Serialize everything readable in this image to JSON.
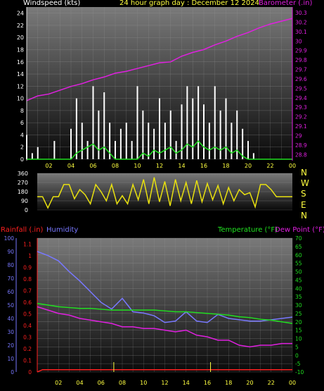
{
  "colors": {
    "wind_axis": "#ffffff",
    "gust": "#ffffff",
    "avg_wind": "#20e020",
    "barometer": "#e020e0",
    "direction": "#e8e010",
    "rain": "#ff2020",
    "humidity": "#7878ff",
    "temperature": "#20e020",
    "dewpoint": "#e020e0",
    "time_axis": "#ffff40"
  },
  "header": {
    "windspeed_label": "Windspeed (kts)",
    "title": "24 hour graph day : December 12 2024",
    "barometer_label": "Barometer (.in)"
  },
  "direction_letters": [
    "N",
    "W",
    "S",
    "E",
    "N"
  ],
  "lower_header": {
    "rainfall_label": "Rainfall (.in)",
    "humidity_label": "Humidity",
    "temperature_label": "Temperature (°F)",
    "dewpoint_label": "Dew Point (°F)"
  },
  "chart_data": [
    {
      "id": "wind-barometer",
      "type": "area",
      "title": "24 hour graph day : December 12 2024",
      "x_ticks": [
        "02",
        "04",
        "06",
        "08",
        "10",
        "12",
        "14",
        "16",
        "18",
        "20",
        "22",
        "00"
      ],
      "y_left": {
        "label": "Windspeed (kts)",
        "ticks": [
          0,
          2,
          4,
          6,
          8,
          10,
          12,
          14,
          16,
          18,
          20,
          22,
          24
        ],
        "range": [
          0,
          25
        ]
      },
      "y_right": {
        "label": "Barometer (.in)",
        "ticks": [
          "28.8",
          "28.9",
          "29",
          "29.1",
          "29.2",
          "29.3",
          "29.4",
          "29.5",
          "29.6",
          "29.7",
          "29.8",
          "29.9",
          "30",
          "30.1",
          "30.2",
          "30.3"
        ],
        "range": [
          28.75,
          30.36
        ]
      },
      "series": [
        {
          "name": "Barometer (.in)",
          "x": [
            0,
            1,
            2,
            3,
            4,
            5,
            6,
            7,
            8,
            9,
            10,
            11,
            12,
            13,
            14,
            15,
            16,
            17,
            18,
            19,
            20,
            21,
            22,
            23,
            24
          ],
          "values": [
            29.37,
            29.42,
            29.44,
            29.48,
            29.52,
            29.55,
            29.59,
            29.62,
            29.66,
            29.68,
            29.71,
            29.74,
            29.77,
            29.78,
            29.84,
            29.88,
            29.91,
            29.96,
            30.0,
            30.05,
            30.09,
            30.14,
            30.18,
            30.21,
            30.24
          ]
        },
        {
          "name": "Gust",
          "x": [
            0,
            0.5,
            1,
            1.5,
            2,
            2.5,
            3,
            3.5,
            4,
            4.5,
            5,
            5.5,
            6,
            6.5,
            7,
            7.5,
            8,
            8.5,
            9,
            9.5,
            10,
            10.5,
            11,
            11.5,
            12,
            12.5,
            13,
            13.5,
            14,
            14.5,
            15,
            15.5,
            16,
            16.5,
            17,
            17.5,
            18,
            18.5,
            19,
            19.5,
            20,
            20.5,
            21,
            21.5,
            22,
            22.5,
            23,
            23.5,
            24
          ],
          "values": [
            4,
            1,
            2,
            0,
            0,
            3,
            0,
            0,
            5,
            10,
            6,
            3,
            12,
            8,
            11,
            6,
            3,
            5,
            6,
            3,
            12,
            8,
            6,
            5,
            10,
            6,
            8,
            3,
            9,
            12,
            10,
            12,
            9,
            6,
            12,
            8,
            10,
            6,
            8,
            5,
            3,
            1,
            0,
            0,
            0,
            0,
            0,
            0,
            0
          ]
        },
        {
          "name": "Average wind",
          "x": [
            0,
            1,
            2,
            3,
            4,
            4.5,
            5,
            5.5,
            6,
            6.5,
            7,
            7.5,
            8,
            9,
            10,
            10.5,
            11,
            11.5,
            12,
            12.5,
            13,
            13.5,
            14,
            14.5,
            15,
            15.5,
            16,
            16.5,
            17,
            17.5,
            18,
            18.5,
            19,
            19.5,
            20,
            21,
            22,
            23,
            24
          ],
          "values": [
            0,
            0,
            0,
            0,
            0,
            1,
            1.5,
            2,
            2.5,
            1.5,
            2,
            1,
            0,
            0,
            0,
            1,
            0.5,
            1.5,
            1,
            1.5,
            2,
            1,
            1.5,
            2.5,
            2,
            3,
            2,
            1.5,
            2,
            1.5,
            2,
            1,
            1.5,
            0.5,
            0,
            0,
            0,
            0,
            0
          ]
        }
      ]
    },
    {
      "id": "wind-direction",
      "type": "line",
      "y_ticks": [
        0,
        90,
        180,
        270,
        360
      ],
      "y_range": [
        0,
        360
      ],
      "series": [
        {
          "name": "Wind direction",
          "x": [
            0,
            0.5,
            1,
            1.5,
            2,
            2.5,
            3,
            3.5,
            4,
            4.5,
            5,
            5.5,
            6,
            6.5,
            7,
            7.5,
            8,
            8.5,
            9,
            9.5,
            10,
            10.5,
            11,
            11.5,
            12,
            12.5,
            13,
            13.5,
            14,
            14.5,
            15,
            15.5,
            16,
            16.5,
            17,
            17.5,
            18,
            18.5,
            19,
            19.5,
            20,
            20.5,
            21,
            21.5,
            22,
            22.5,
            23,
            23.5,
            24
          ],
          "values": [
            130,
            130,
            20,
            130,
            130,
            250,
            250,
            110,
            200,
            150,
            60,
            250,
            180,
            90,
            250,
            60,
            140,
            60,
            250,
            100,
            300,
            60,
            320,
            80,
            280,
            40,
            300,
            90,
            270,
            60,
            290,
            80,
            260,
            100,
            240,
            60,
            220,
            90,
            200,
            150,
            170,
            30,
            250,
            250,
            200,
            130,
            130,
            130,
            130
          ]
        }
      ]
    },
    {
      "id": "rain-humidity-temperature",
      "type": "line",
      "x_ticks": [
        "02",
        "04",
        "06",
        "08",
        "10",
        "12",
        "14",
        "16",
        "18",
        "20",
        "22",
        "00"
      ],
      "y_left_outer": {
        "label": "Humidity",
        "ticks": [
          0,
          10,
          20,
          30,
          40,
          50,
          60,
          70,
          80,
          90,
          100
        ],
        "range": [
          0,
          100
        ]
      },
      "y_left_inner": {
        "label": "Rainfall (.in)",
        "ticks": [
          "0",
          "0.1",
          "0.2",
          "0.3",
          "0.4",
          "0.5",
          "0.6",
          "0.7",
          "0.8",
          "0.9",
          "1",
          "1.1"
        ],
        "range": [
          0,
          1.15
        ]
      },
      "y_right": {
        "label": "Temperature (°F)",
        "ticks": [
          -10,
          -5,
          0,
          5,
          10,
          15,
          20,
          25,
          30,
          35,
          40,
          45,
          50,
          55,
          60,
          65,
          70
        ],
        "range": [
          -10,
          70
        ]
      },
      "series": [
        {
          "name": "Humidity",
          "axis": "humidity",
          "x": [
            0,
            1,
            2,
            3,
            4,
            5,
            6,
            7,
            8,
            9,
            10,
            11,
            12,
            13,
            14,
            15,
            16,
            17,
            18,
            19,
            20,
            21,
            22,
            23,
            24
          ],
          "values": [
            90,
            87,
            83,
            75,
            68,
            60,
            52,
            47,
            55,
            45,
            44,
            42,
            37,
            38,
            45,
            38,
            37,
            43,
            40,
            39,
            38,
            38,
            39,
            40,
            41
          ]
        },
        {
          "name": "Temperature (°F)",
          "axis": "temperature",
          "x": [
            0,
            1,
            2,
            3,
            4,
            5,
            6,
            7,
            8,
            9,
            10,
            11,
            12,
            13,
            14,
            15,
            16,
            17,
            18,
            19,
            20,
            21,
            22,
            23,
            24
          ],
          "values": [
            31,
            30,
            29,
            28.5,
            28,
            28,
            27.5,
            27,
            27,
            27,
            27,
            27,
            26.5,
            26,
            26,
            25.5,
            25,
            24.5,
            24,
            23,
            22.5,
            21.5,
            21,
            20,
            19
          ]
        },
        {
          "name": "Dew Point (°F)",
          "axis": "temperature",
          "x": [
            0,
            1,
            2,
            3,
            4,
            5,
            6,
            7,
            8,
            9,
            10,
            11,
            12,
            13,
            14,
            15,
            16,
            17,
            18,
            19,
            20,
            21,
            22,
            23,
            24
          ],
          "values": [
            29,
            27,
            25,
            24,
            22,
            21,
            20,
            19,
            17,
            17,
            16,
            16,
            15,
            14,
            15,
            12,
            11,
            9,
            9,
            6,
            5,
            6,
            6,
            7,
            7
          ]
        },
        {
          "name": "Rainfall (.in)",
          "axis": "rain",
          "x": [
            0,
            0.5,
            1,
            24
          ],
          "values": [
            0,
            0.02,
            0.02,
            0.02
          ]
        }
      ]
    }
  ]
}
